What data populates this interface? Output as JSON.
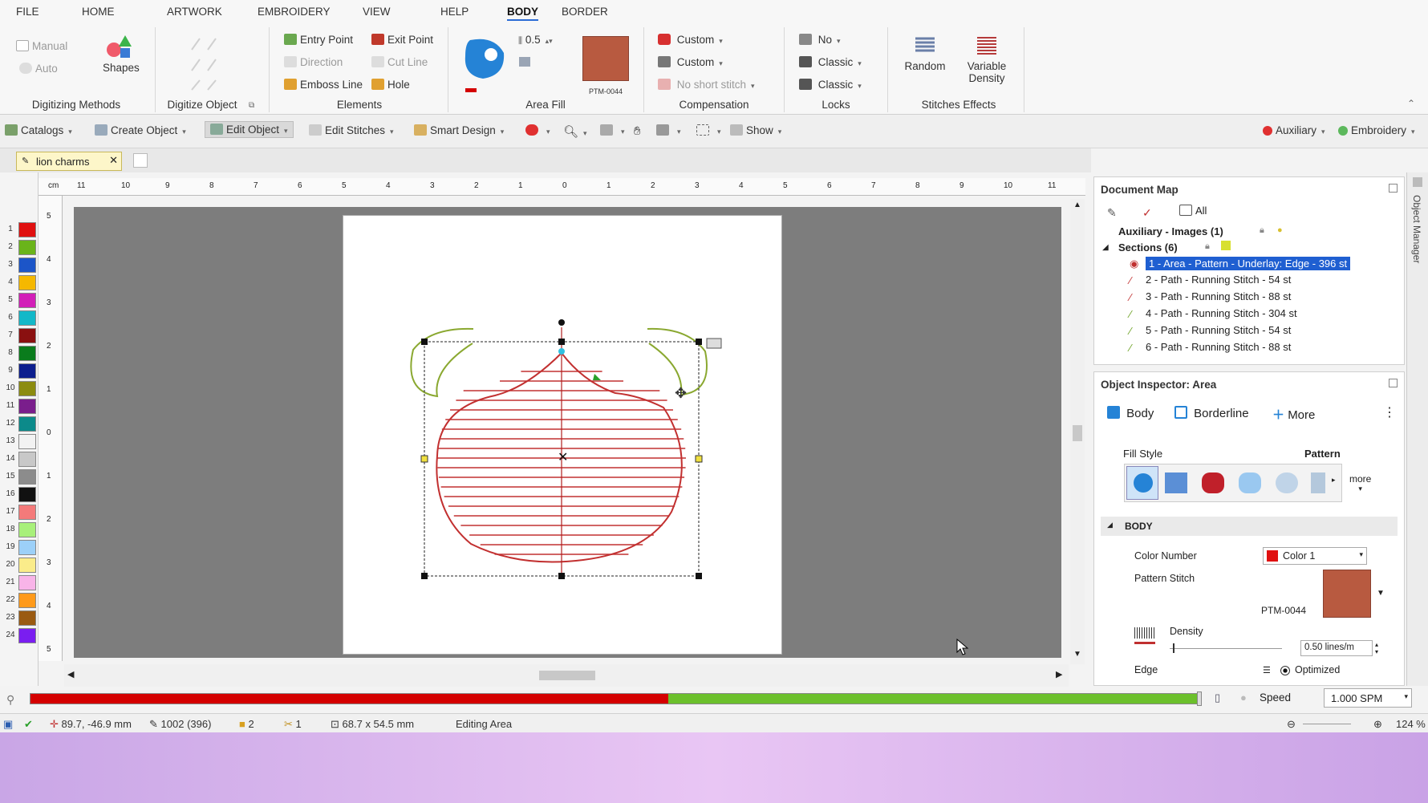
{
  "menu": [
    "FILE",
    "HOME",
    "ARTWORK",
    "EMBROIDERY",
    "VIEW",
    "HELP",
    "BODY",
    "BORDER"
  ],
  "ribbon": {
    "digitizing": {
      "manual": "Manual",
      "auto": "Auto",
      "shapes": "Shapes",
      "group": "Digitizing Methods"
    },
    "digitize_object": {
      "group": "Digitize Object"
    },
    "elements": {
      "entry": "Entry Point",
      "exit": "Exit Point",
      "direction": "Direction",
      "cutline": "Cut Line",
      "emboss": "Emboss Line",
      "hole": "Hole",
      "group": "Elements"
    },
    "area_fill": {
      "value": "0.5",
      "pattern": "PTM-0044",
      "group": "Area Fill"
    },
    "compensation": {
      "c1": "Custom",
      "c2": "Custom",
      "c3": "No short stitch",
      "group": "Compensation"
    },
    "locks": {
      "l1": "No",
      "l2": "Classic",
      "l3": "Classic",
      "group": "Locks"
    },
    "effects": {
      "random": "Random",
      "variable": "Variable",
      "density": "Density",
      "group": "Stitches Effects"
    }
  },
  "toolbar": {
    "catalogs": "Catalogs",
    "create": "Create Object",
    "edit": "Edit Object",
    "stitches": "Edit Stitches",
    "smart": "Smart Design",
    "show": "Show",
    "auxiliary": "Auxiliary",
    "embroidery": "Embroidery"
  },
  "tab": {
    "name": "lion charms"
  },
  "palette": {
    "numbers": [
      "1",
      "2",
      "3",
      "4",
      "5",
      "6",
      "7",
      "8",
      "9",
      "10",
      "11",
      "12",
      "13",
      "14",
      "15",
      "16",
      "17",
      "18",
      "19",
      "20",
      "21",
      "22",
      "23",
      "24"
    ],
    "colors": [
      "#e01010",
      "#6ab41a",
      "#1c55c8",
      "#f5b800",
      "#d21fb8",
      "#12b8c8",
      "#8a1010",
      "#0a7c1c",
      "#0c1e8e",
      "#8c8c10",
      "#7a1e8c",
      "#0c8a8a",
      "#f2f2f2",
      "#c8c8c8",
      "#8c8c8c",
      "#111111",
      "#f47a7a",
      "#a8f07a",
      "#9cd0f8",
      "#faec8a",
      "#f8b4e8",
      "#ff9a1a",
      "#9a5a12",
      "#7a1ef0"
    ]
  },
  "ruler": {
    "unit": "cm",
    "htick": [
      "11",
      "10",
      "9",
      "8",
      "7",
      "6",
      "5",
      "4",
      "3",
      "2",
      "1",
      "0",
      "1",
      "2",
      "3",
      "4",
      "5",
      "6",
      "7",
      "8",
      "9",
      "10",
      "11"
    ],
    "vtick": [
      "5",
      "4",
      "3",
      "2",
      "1",
      "0",
      "1",
      "2",
      "3",
      "4",
      "5"
    ]
  },
  "docmap": {
    "title": "Document Map",
    "all": "All",
    "aux": "Auxiliary - Images (1)",
    "sections": "Sections (6)",
    "items": [
      "1 - Area - Pattern - Underlay: Edge - 396 st",
      "2 - Path - Running Stitch - 54 st",
      "3 - Path - Running Stitch - 88 st",
      "4 - Path - Running Stitch - 304 st",
      "5 - Path - Running Stitch - 54 st",
      "6 - Path - Running Stitch - 88 st"
    ]
  },
  "inspector": {
    "title": "Object Inspector: Area",
    "tab_body": "Body",
    "tab_border": "Borderline",
    "tab_more": "More",
    "fill_style": "Fill Style",
    "fill_value": "Pattern",
    "more": "more",
    "section": "BODY",
    "color_label": "Color Number",
    "color_value": "Color 1",
    "pattern_label": "Pattern Stitch",
    "pattern_value": "PTM-0044",
    "density_label": "Density",
    "density_value": "0.50 lines/m",
    "edge_label": "Edge",
    "edge_value": "Optimized",
    "color_hex": "#e01010"
  },
  "side": {
    "label": "Object Manager"
  },
  "speed": {
    "label": "Speed",
    "value": "1.000 SPM",
    "progress": 0.455
  },
  "status": {
    "coords": "89.7, -46.9 mm",
    "stitches": "1002 (396)",
    "colors": "2",
    "stops": "1",
    "size": "68.7 x 54.5 mm",
    "mode": "Editing Area",
    "zoom": "124 %"
  }
}
